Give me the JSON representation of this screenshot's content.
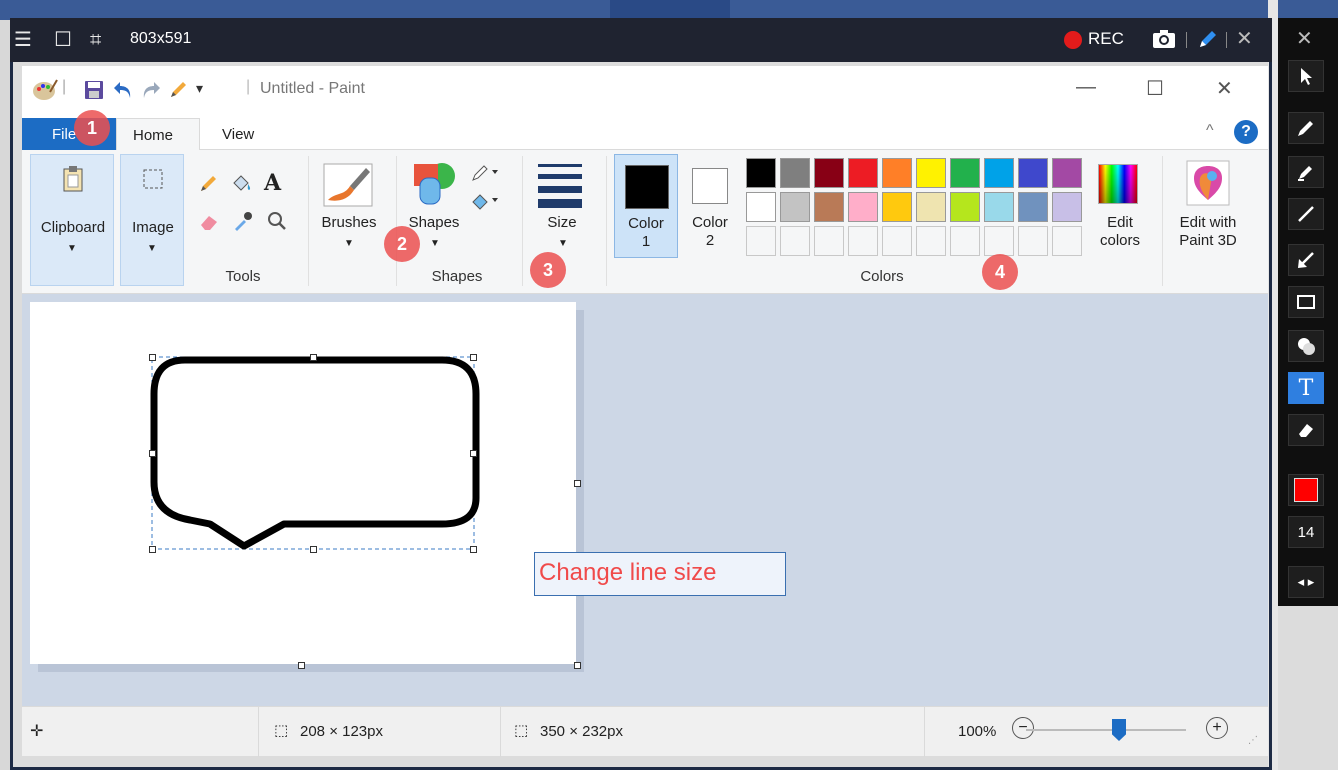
{
  "recorder": {
    "dimensions": "803x591",
    "rec_label": "REC",
    "size_value": "14",
    "pen_color": "#ff0000"
  },
  "paint": {
    "title": "Untitled - Paint",
    "tabs": {
      "file": "File",
      "home": "Home",
      "view": "View"
    },
    "ribbon": {
      "clipboard": "Clipboard",
      "image": "Image",
      "tools_group": "Tools",
      "brushes": "Brushes",
      "shapes": "Shapes",
      "shapes_group": "Shapes",
      "size": "Size",
      "color1": [
        "Color",
        "1"
      ],
      "color2": [
        "Color",
        "2"
      ],
      "edit_colors": [
        "Edit",
        "colors"
      ],
      "colors_group": "Colors",
      "edit_paint3d": [
        "Edit with",
        "Paint 3D"
      ]
    },
    "palette_row1": [
      "#000000",
      "#7f7f7f",
      "#880015",
      "#ed1c24",
      "#ff7f27",
      "#fff200",
      "#22b14c",
      "#00a2e8",
      "#3f48cc",
      "#a349a4"
    ],
    "palette_row2": [
      "#ffffff",
      "#c3c3c3",
      "#b97a57",
      "#ffaec9",
      "#ffc90e",
      "#efe4b0",
      "#b5e61d",
      "#99d9ea",
      "#7092be",
      "#c8bfe7"
    ],
    "annotation": "Change line size",
    "status": {
      "selection_size": "208 × 123px",
      "canvas_size": "350 × 232px",
      "zoom": "100%"
    }
  },
  "callouts": [
    "1",
    "2",
    "3",
    "4"
  ]
}
